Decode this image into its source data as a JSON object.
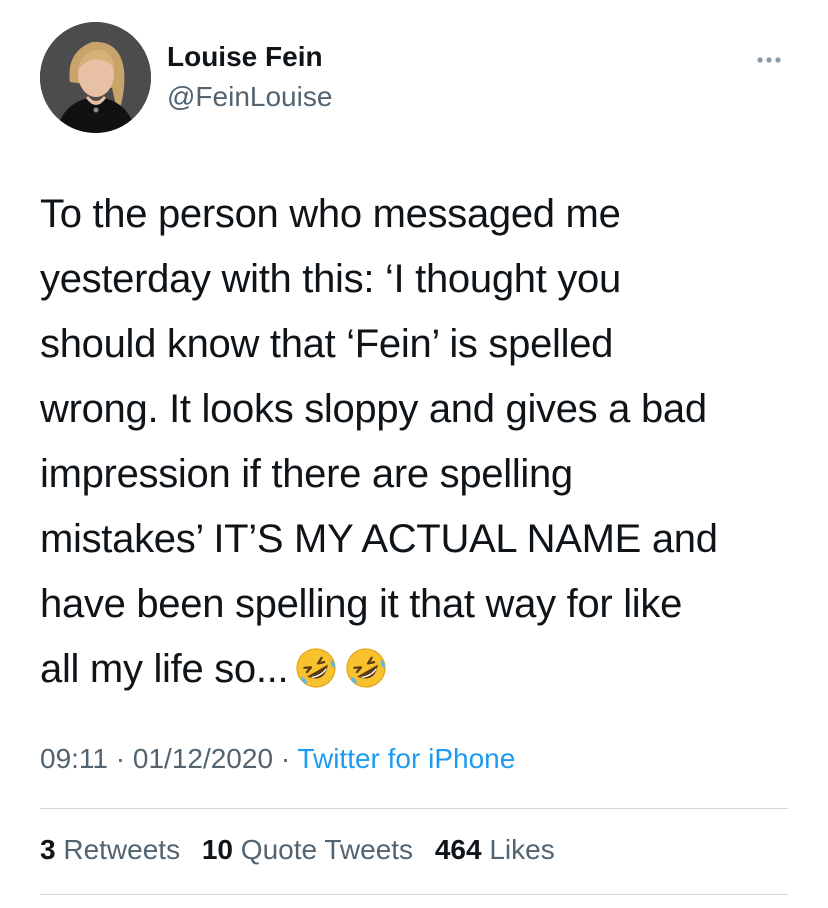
{
  "user": {
    "name": "Louise Fein",
    "handle": "@FeinLouise"
  },
  "tweet": {
    "lines": [
      "To the person who messaged me",
      "yesterday with this: ‘I thought you",
      "should know that ‘Fein’ is spelled",
      "wrong. It looks sloppy and gives a bad",
      "impression if there are spelling",
      "mistakes’ IT’S MY ACTUAL NAME and",
      "have been spelling it that way for like",
      "all my life so..."
    ],
    "emojis": [
      "rolling-on-floor-laughing-icon",
      "rolling-on-floor-laughing-icon"
    ]
  },
  "meta": {
    "time": "09:11",
    "separator": "·",
    "date": "01/12/2020",
    "source": "Twitter for iPhone"
  },
  "stats": {
    "retweets_count": "3",
    "retweets_label": "Retweets",
    "quotes_count": "10",
    "quotes_label": "Quote Tweets",
    "likes_count": "464",
    "likes_label": "Likes"
  },
  "colors": {
    "text": "#0f1419",
    "secondary": "#536471",
    "link": "#1d9bf0",
    "divider": "#cfd9de"
  },
  "icons": {
    "more": "more-options-icon",
    "emoji": "rolling-on-floor-laughing-icon"
  }
}
